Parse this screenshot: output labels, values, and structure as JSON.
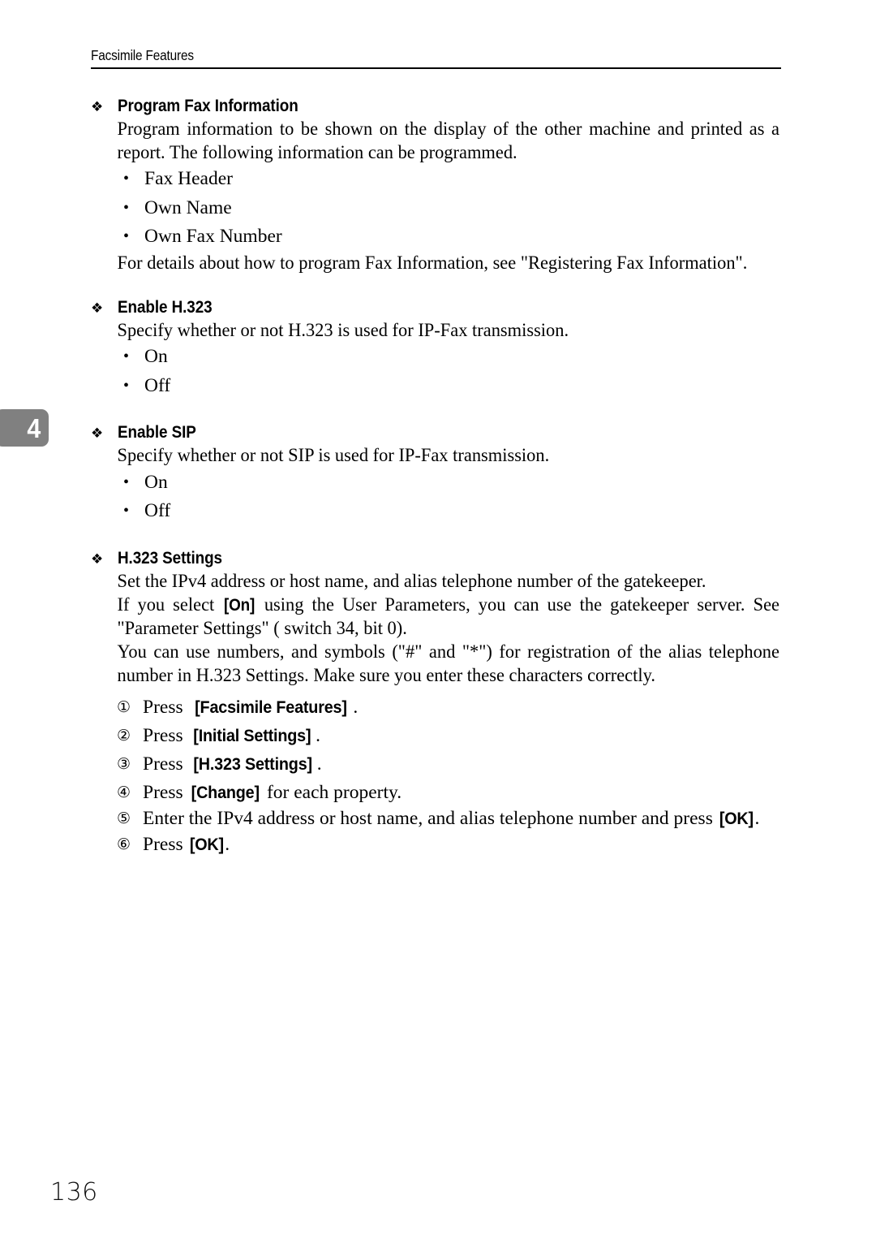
{
  "header": {
    "title": "Facsimile Features"
  },
  "chapter_tab": {
    "number": "4"
  },
  "folio": {
    "page_number": "136"
  },
  "glyphs": {
    "floret": "❖",
    "dot": "•",
    "circled": [
      "①",
      "②",
      "③",
      "④",
      "⑤",
      "⑥"
    ]
  },
  "sections": [
    {
      "heading": "Program Fax Information",
      "intro": "Program information to be shown on the display of the other machine and printed as a report. The following information can be programmed.",
      "bullets": [
        "Fax Header",
        "Own Name",
        "Own Fax Number"
      ],
      "outro": "For details about how to program Fax Information, see \"Registering Fax Information\"."
    },
    {
      "heading": "Enable H.323",
      "intro": "Specify whether or not H.323 is used for IP-Fax transmission.",
      "bullets": [
        "On",
        "Off"
      ]
    },
    {
      "heading": "Enable SIP",
      "intro": "Specify whether or not SIP is used for IP-Fax transmission.",
      "bullets": [
        "On",
        "Off"
      ]
    },
    {
      "heading": "H.323 Settings",
      "para1": "Set the IPv4 address or host name, and alias telephone number of the gatekeeper.",
      "para2_before": "If you select ",
      "para2_key": "[On]",
      "para2_after": " using the User Parameters, you can use the gatekeeper server. See \"Parameter Settings\" ( switch 34, bit 0).",
      "para3": "You can use numbers, and symbols (\"#\" and \"*\") for registration of the alias telephone number in H.323 Settings. Make sure you enter these characters correctly.",
      "steps": [
        {
          "before": "Press ",
          "key": "[Facsimile Features]",
          "after": "."
        },
        {
          "before": "Press ",
          "key": "[Initial Settings]",
          "after": "."
        },
        {
          "before": "Press ",
          "key": "[H.323 Settings]",
          "after": "."
        },
        {
          "before": "Press ",
          "key": "[Change]",
          "after": " for each property."
        },
        {
          "before": "Enter the IPv4 address or host name, and alias telephone number and press ",
          "key": "[OK]",
          "after": "."
        },
        {
          "before": "Press ",
          "key": "[OK]",
          "after": "."
        }
      ]
    }
  ]
}
